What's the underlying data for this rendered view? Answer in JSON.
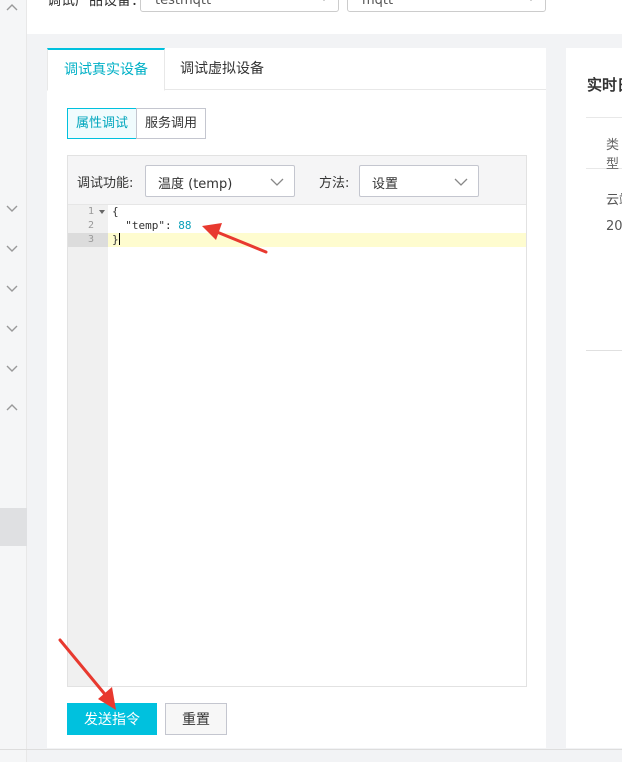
{
  "topbar": {
    "label": "调试产品设备：",
    "product_select": "testmqtt",
    "device_select": "mqtt"
  },
  "tabs": [
    {
      "label": "调试真实设备",
      "active": true
    },
    {
      "label": "调试虚拟设备",
      "active": false
    }
  ],
  "segment": {
    "property_debug": "属性调试",
    "service_call": "服务调用"
  },
  "toolbar": {
    "function_label": "调试功能:",
    "function_value": "温度 (temp)",
    "method_label": "方法:",
    "method_value": "设置"
  },
  "editor": {
    "line_numbers": [
      "1",
      "2",
      "3"
    ],
    "lines": {
      "l1": "{",
      "l2_key": "  \"temp\": ",
      "l2_value": "88",
      "l3": "}"
    }
  },
  "actions": {
    "send": "发送指令",
    "reset": "重置"
  },
  "right_panel": {
    "title": "实时日志",
    "header": "类型",
    "row1": "云端",
    "row2": "20"
  },
  "colors": {
    "accent": "#00c1de",
    "annotation_arrow": "#e8392f"
  },
  "annotations": [
    "arrow-pointing-to-temp-value",
    "arrow-pointing-to-send-button"
  ]
}
